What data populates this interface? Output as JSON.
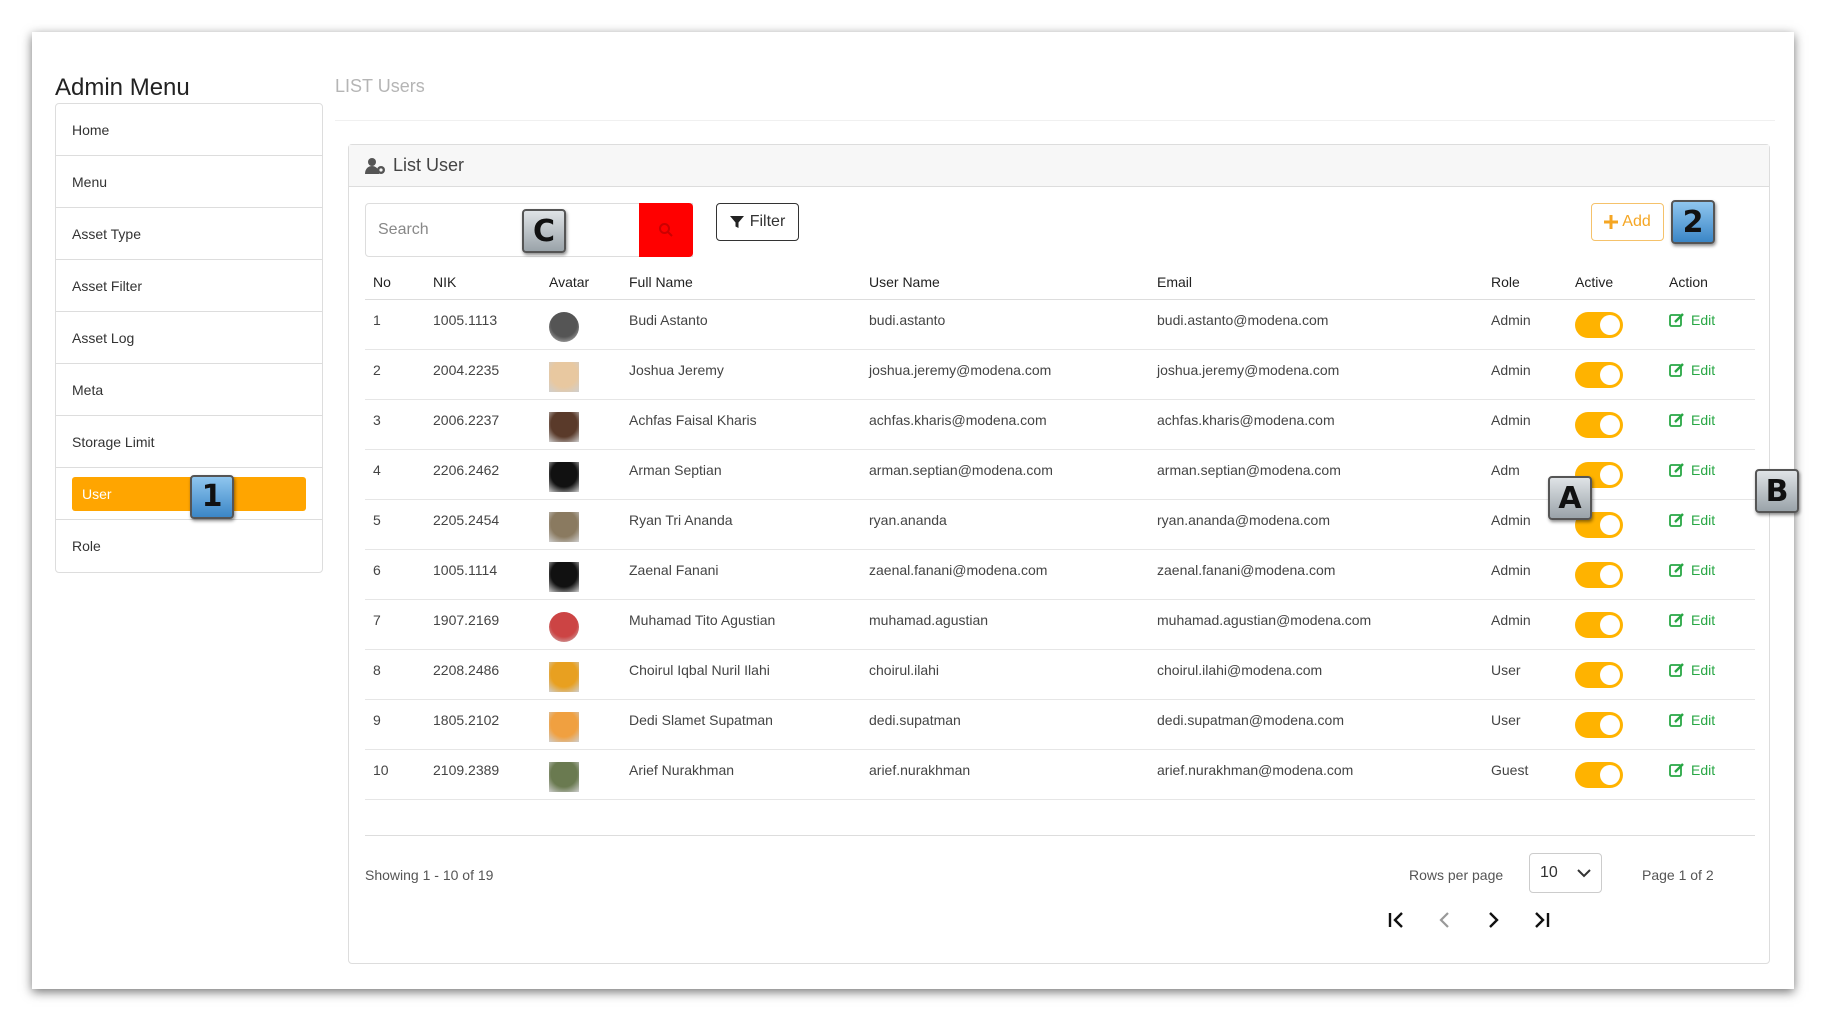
{
  "sidebar": {
    "title": "Admin Menu",
    "items": [
      {
        "label": "Home"
      },
      {
        "label": "Menu"
      },
      {
        "label": "Asset Type"
      },
      {
        "label": "Asset Filter"
      },
      {
        "label": "Asset Log"
      },
      {
        "label": "Meta"
      },
      {
        "label": "Storage Limit"
      },
      {
        "label": "User",
        "active": true
      },
      {
        "label": "Role"
      }
    ]
  },
  "header": {
    "title": "LIST Users"
  },
  "card": {
    "title": "List User"
  },
  "search": {
    "placeholder": "Search"
  },
  "toolbar": {
    "filter_label": "Filter",
    "add_label": "Add"
  },
  "badges": {
    "one": "1",
    "two": "2",
    "a": "A",
    "b": "B",
    "c": "C"
  },
  "table": {
    "columns": [
      "No",
      "NIK",
      "Avatar",
      "Full Name",
      "User Name",
      "Email",
      "Role",
      "Active",
      "Action"
    ],
    "edit_label": "Edit",
    "rows": [
      {
        "no": "1",
        "nik": "1005.1113",
        "full_name": "Budi Astanto",
        "user_name": "budi.astanto",
        "email": "budi.astanto@modena.com",
        "role": "Admin",
        "active": true
      },
      {
        "no": "2",
        "nik": "2004.2235",
        "full_name": "Joshua Jeremy",
        "user_name": "joshua.jeremy@modena.com",
        "email": "joshua.jeremy@modena.com",
        "role": "Admin",
        "active": true
      },
      {
        "no": "3",
        "nik": "2006.2237",
        "full_name": "Achfas Faisal Kharis",
        "user_name": "achfas.kharis@modena.com",
        "email": "achfas.kharis@modena.com",
        "role": "Admin",
        "active": true
      },
      {
        "no": "4",
        "nik": "2206.2462",
        "full_name": "Arman Septian",
        "user_name": "arman.septian@modena.com",
        "email": "arman.septian@modena.com",
        "role": "Adm",
        "active": true
      },
      {
        "no": "5",
        "nik": "2205.2454",
        "full_name": "Ryan Tri Ananda",
        "user_name": "ryan.ananda",
        "email": "ryan.ananda@modena.com",
        "role": "Admin",
        "active": true
      },
      {
        "no": "6",
        "nik": "1005.1114",
        "full_name": "Zaenal Fanani",
        "user_name": "zaenal.fanani@modena.com",
        "email": "zaenal.fanani@modena.com",
        "role": "Admin",
        "active": true
      },
      {
        "no": "7",
        "nik": "1907.2169",
        "full_name": "Muhamad Tito Agustian",
        "user_name": "muhamad.agustian",
        "email": "muhamad.agustian@modena.com",
        "role": "Admin",
        "active": true
      },
      {
        "no": "8",
        "nik": "2208.2486",
        "full_name": "Choirul Iqbal Nuril Ilahi",
        "user_name": "choirul.ilahi",
        "email": "choirul.ilahi@modena.com",
        "role": "User",
        "active": true
      },
      {
        "no": "9",
        "nik": "1805.2102",
        "full_name": "Dedi Slamet Supatman",
        "user_name": "dedi.supatman",
        "email": "dedi.supatman@modena.com",
        "role": "User",
        "active": true
      },
      {
        "no": "10",
        "nik": "2109.2389",
        "full_name": "Arief Nurakhman",
        "user_name": "arief.nurakhman",
        "email": "arief.nurakhman@modena.com",
        "role": "Guest",
        "active": true
      }
    ]
  },
  "footer": {
    "showing": "Showing 1 - 10 of 19",
    "rows_per_page_label": "Rows per page",
    "rows_per_page_value": "10",
    "page_info": "Page 1 of 2"
  },
  "colors": {
    "accent": "#ffa500",
    "toggle": "#ffb300",
    "search_button": "#ff0000",
    "edit": "#28a745"
  },
  "icons": [
    "user-cog-icon",
    "search-icon",
    "filter-icon",
    "plus-icon",
    "edit-icon",
    "chevron-down-icon",
    "first-page-icon",
    "prev-page-icon",
    "next-page-icon",
    "last-page-icon"
  ]
}
